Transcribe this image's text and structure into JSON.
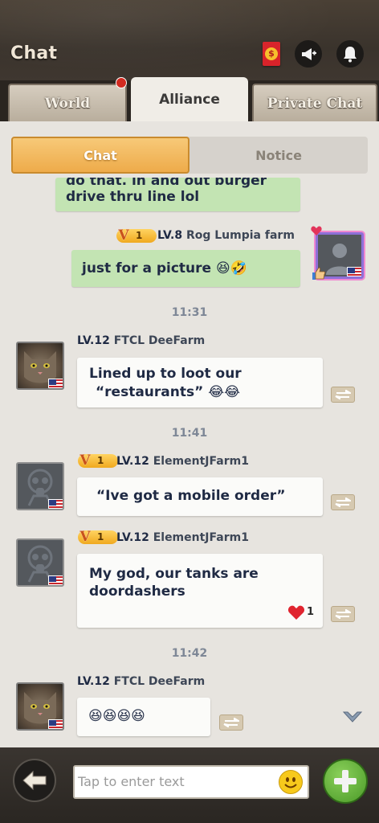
{
  "header": {
    "title": "Chat",
    "redpacket_symbol": "$"
  },
  "tabs": {
    "world": "World",
    "alliance": "Alliance",
    "private": "Private Chat"
  },
  "subtabs": {
    "chat": "Chat",
    "notice": "Notice"
  },
  "messages": [
    {
      "id": "m0",
      "text_top": "do that. in and out burger",
      "text": "drive thru line lol"
    },
    {
      "id": "m1",
      "vip": "1",
      "level": "LV.8",
      "sender": "Rog Lumpia farm",
      "text": "just for a picture 😆🤣"
    },
    {
      "id": "t1",
      "time": "11:31"
    },
    {
      "id": "m2",
      "level": "LV.12",
      "sender": "FTCL DeeFarm",
      "line1": "Lined up to loot our",
      "line2": "“restaurants”  😂😂"
    },
    {
      "id": "t2",
      "time": "11:41"
    },
    {
      "id": "m3",
      "vip": "1",
      "level": "LV.12",
      "sender": "ElementJFarm1",
      "text": "“Ive got a mobile order”"
    },
    {
      "id": "m4",
      "vip": "1",
      "level": "LV.12",
      "sender": "ElementJFarm1",
      "line1": "My god, our tanks are",
      "line2": "doordashers",
      "reaction_count": "1"
    },
    {
      "id": "t3",
      "time": "11:42"
    },
    {
      "id": "m5",
      "level": "LV.12",
      "sender": "FTCL DeeFarm",
      "text": "😆😆😆😆"
    }
  ],
  "input": {
    "placeholder": "Tap to enter text"
  },
  "colors": {
    "active_subtab": "#eeab4a",
    "own_bubble": "#c3e4b3",
    "other_bubble": "#fbfbf9",
    "panel_bg": "#e7e4df"
  }
}
